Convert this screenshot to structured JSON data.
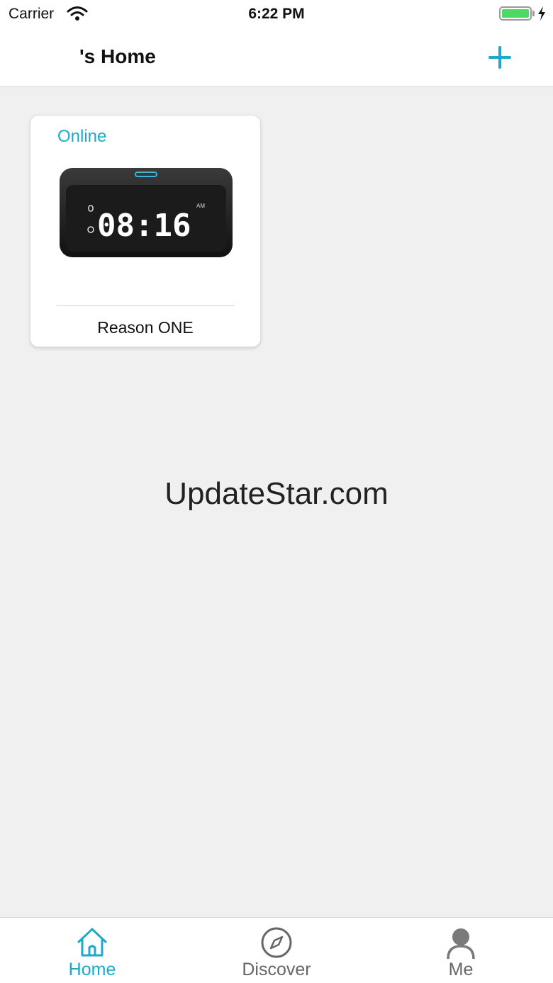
{
  "status_bar": {
    "carrier": "Carrier",
    "time": "6:22 PM"
  },
  "nav": {
    "title": "'s Home",
    "add_icon": "plus-icon"
  },
  "device_card": {
    "status": "Online",
    "display_time": "08:16",
    "display_period": "AM",
    "name": "Reason ONE"
  },
  "watermark": "UpdateStar.com",
  "tabs": [
    {
      "label": "Home",
      "icon": "home-icon",
      "active": true
    },
    {
      "label": "Discover",
      "icon": "compass-icon",
      "active": false
    },
    {
      "label": "Me",
      "icon": "person-icon",
      "active": false
    }
  ],
  "colors": {
    "accent": "#1fa9c9",
    "background": "#f0f0f0",
    "battery": "#4cd964"
  }
}
